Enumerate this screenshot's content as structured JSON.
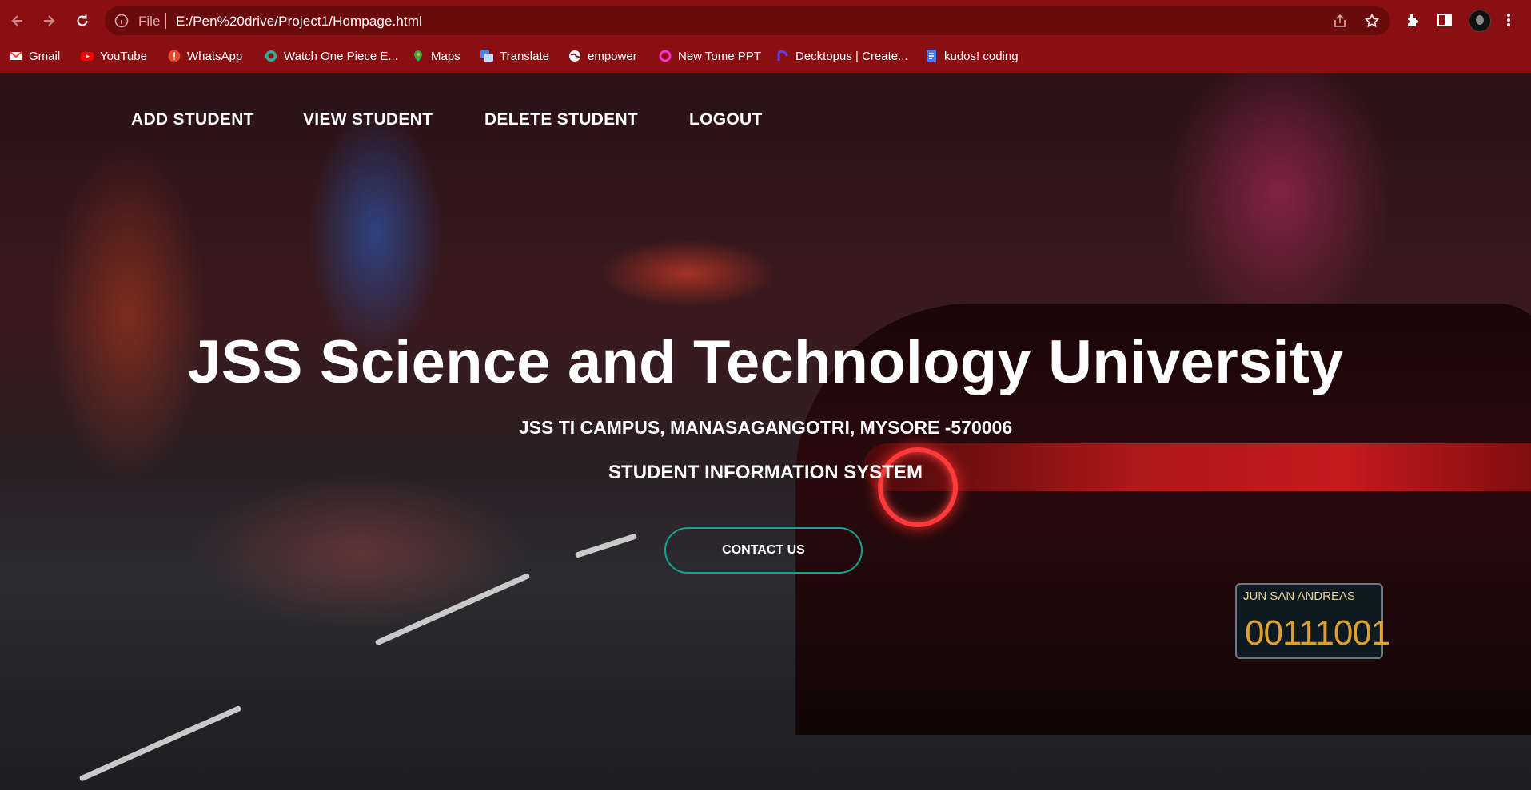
{
  "browser": {
    "url_scheme": "File",
    "url": "E:/Pen%20drive/Project1/Hompage.html",
    "bookmarks": [
      {
        "label": "Gmail",
        "icon": "gmail-icon",
        "color": "#ea4335"
      },
      {
        "label": "YouTube",
        "icon": "youtube-icon",
        "color": "#ff0000"
      },
      {
        "label": "WhatsApp",
        "icon": "whatsapp-icon",
        "color": "#e8452c"
      },
      {
        "label": "Watch One Piece E...",
        "icon": "one-piece-icon",
        "color": "#2ab0a0"
      },
      {
        "label": "Maps",
        "icon": "maps-icon",
        "color": "#34a853"
      },
      {
        "label": "Translate",
        "icon": "translate-icon",
        "color": "#4285f4"
      },
      {
        "label": "empower",
        "icon": "globe-icon",
        "color": "#ffffff"
      },
      {
        "label": "New Tome PPT",
        "icon": "tome-icon",
        "color": "#ff2ad0"
      },
      {
        "label": "Decktopus | Create...",
        "icon": "decktopus-icon",
        "color": "#5b3df5"
      },
      {
        "label": "kudos! coding",
        "icon": "kudos-icon",
        "color": "#4a7cf0"
      }
    ]
  },
  "page": {
    "nav": [
      {
        "label": "ADD STUDENT"
      },
      {
        "label": "VIEW STUDENT"
      },
      {
        "label": "DELETE STUDENT"
      },
      {
        "label": "LOGOUT"
      }
    ],
    "title": "JSS Science and Technology University",
    "subtitle": "JSS TI CAMPUS, MANASAGANGOTRI, MYSORE -570006",
    "system_name": "STUDENT INFORMATION SYSTEM",
    "contact_label": "CONTACT US",
    "plate_top": "JUN SAN ANDREAS",
    "plate_number": "00111001"
  }
}
